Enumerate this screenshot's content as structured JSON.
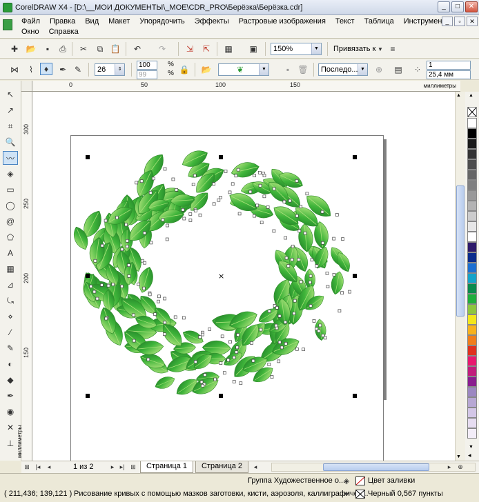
{
  "window": {
    "title": "CorelDRAW X4 - [D:\\__МОИ ДОКУМЕНТЫ\\_MOE\\CDR_PRO\\Берёзка\\Берёзка.cdr]",
    "controls": {
      "minimize": "_",
      "maximize": "□",
      "close": "✕"
    }
  },
  "menu": {
    "row1": [
      "Файл",
      "Правка",
      "Вид",
      "Макет",
      "Упорядочить",
      "Эффекты",
      "Растровые изображения",
      "Текст",
      "Таблица",
      "Инструменты"
    ],
    "row2": [
      "Окно",
      "Справка"
    ],
    "doc_controls": {
      "minimize": "_",
      "restore": "▫",
      "close": "✕"
    }
  },
  "standard_toolbar": {
    "zoom_value": "150%",
    "snap_label": "Привязать к"
  },
  "property_bar": {
    "artistic_width": "26",
    "scale_x": "100",
    "scale_y": "99",
    "percent": "%",
    "layer_select": "Последо...",
    "copies": "1",
    "stroke_width": "25,4 мм"
  },
  "rulers": {
    "units": "миллиметры",
    "h_ticks": [
      "0",
      "50",
      "100",
      "150"
    ],
    "v_ticks": [
      "300",
      "250",
      "200",
      "150"
    ]
  },
  "palette_colors": [
    "#ffffff",
    "#000000",
    "#1a1a1a",
    "#333333",
    "#4d4d4d",
    "#666666",
    "#808080",
    "#999999",
    "#b3b3b3",
    "#cccccc",
    "#e6e6e6",
    "#ffffff",
    "#2e1a6b",
    "#0b2c8c",
    "#1c6fd1",
    "#14a3c9",
    "#0b8a4c",
    "#1fae3c",
    "#8ec63f",
    "#f2e61b",
    "#f7b21c",
    "#f07d1a",
    "#e0301e",
    "#e8186e",
    "#c11d7c",
    "#8a1d8f",
    "#9c87c1",
    "#b7a7d3",
    "#d3c6e6",
    "#e6dcf0",
    "#f3edf8"
  ],
  "pages": {
    "count_label": "1 из 2",
    "tabs": [
      "Страница 1",
      "Страница 2"
    ],
    "active_index": 0
  },
  "status": {
    "coords": "( 211,436; 139,121 )",
    "hint": "Рисование кривых с помощью мазков заготовки, кисти, аэрозоля, каллиграфичес...",
    "selection": "Группа Художественное о...",
    "fill_label": "Цвет заливки",
    "outline_label": "Черный  0,567 пункты"
  }
}
